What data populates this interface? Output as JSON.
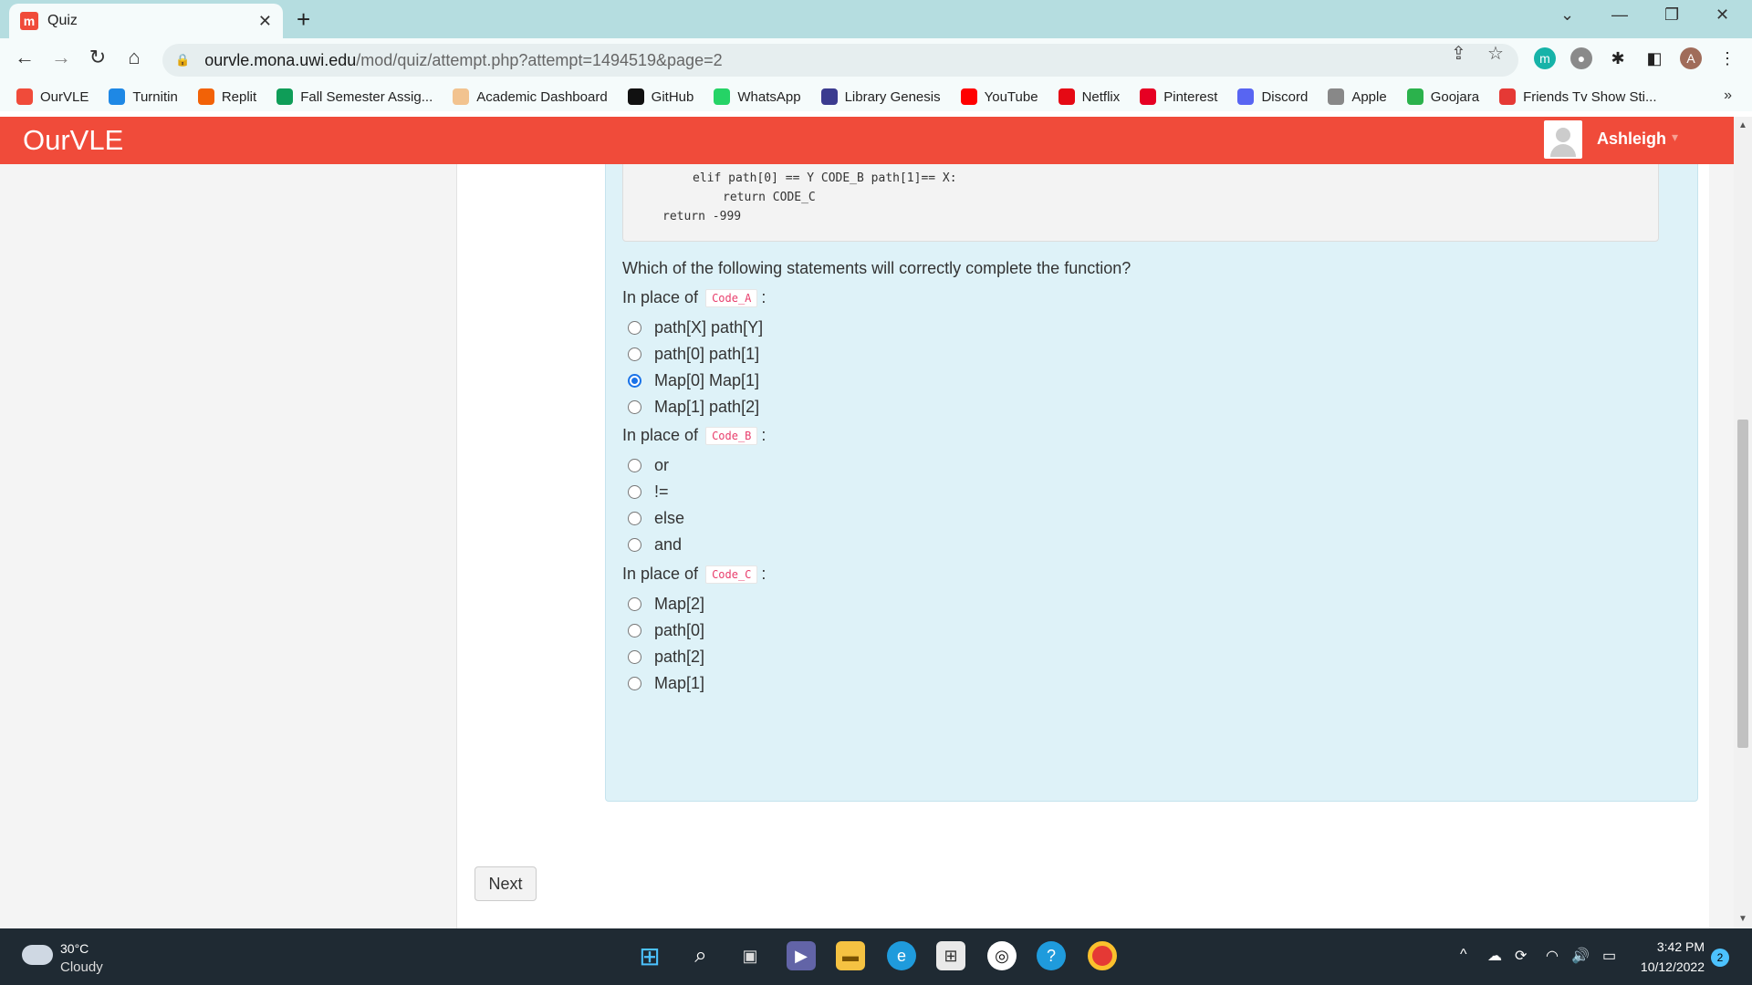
{
  "browser": {
    "tab_title": "Quiz",
    "url_host": "ourvle.mona.uwi.edu",
    "url_path": "/mod/quiz/attempt.php?attempt=1494519&page=2",
    "profile_initial": "A",
    "extension_initial": "m"
  },
  "bookmarks": [
    {
      "label": "OurVLE",
      "icon": "ourvle-icon",
      "color": "#f04b3a"
    },
    {
      "label": "Turnitin",
      "icon": "turnitin-icon",
      "color": "#1e88e5"
    },
    {
      "label": "Replit",
      "icon": "replit-icon",
      "color": "#f26207"
    },
    {
      "label": "Fall Semester Assig...",
      "icon": "sheets-icon",
      "color": "#0f9d58"
    },
    {
      "label": "Academic Dashboard",
      "icon": "dashboard-icon",
      "color": "#f2c38f"
    },
    {
      "label": "GitHub",
      "icon": "github-icon",
      "color": "#111111"
    },
    {
      "label": "WhatsApp",
      "icon": "whatsapp-icon",
      "color": "#25d366"
    },
    {
      "label": "Library Genesis",
      "icon": "libgen-icon",
      "color": "#3b3b8f"
    },
    {
      "label": "YouTube",
      "icon": "youtube-icon",
      "color": "#ff0000"
    },
    {
      "label": "Netflix",
      "icon": "netflix-icon",
      "color": "#e50914"
    },
    {
      "label": "Pinterest",
      "icon": "pinterest-icon",
      "color": "#e60023"
    },
    {
      "label": "Discord",
      "icon": "discord-icon",
      "color": "#5865f2"
    },
    {
      "label": "Apple",
      "icon": "apple-icon",
      "color": "#888888"
    },
    {
      "label": "Goojara",
      "icon": "goojara-icon",
      "color": "#2bb24c"
    },
    {
      "label": "Friends Tv Show Sti...",
      "icon": "friends-icon",
      "color": "#e53935"
    }
  ],
  "site": {
    "brand": "OurVLE",
    "user_name": "Ashleigh",
    "brand_color": "#f04b3a"
  },
  "question": {
    "code_lines": [
      "elif path[0] == Y CODE_B path[1]== X:",
      "return CODE_C",
      "return -999"
    ],
    "prompt": "Which of the following statements will correctly complete the function?",
    "groups": [
      {
        "label": "In place of",
        "code": "Code_A",
        "suffix": ":",
        "options": [
          "path[X] path[Y]",
          "path[0] path[1]",
          "Map[0] Map[1]",
          "Map[1] path[2]"
        ],
        "selected": 2
      },
      {
        "label": "In place of",
        "code": "Code_B",
        "suffix": ":",
        "options": [
          "or",
          "!=",
          "else",
          "and"
        ],
        "selected": -1
      },
      {
        "label": "In place of",
        "code": "Code_C",
        "suffix": ":",
        "options": [
          "Map[2]",
          "path[0]",
          "path[2]",
          "Map[1]"
        ],
        "selected": -1
      }
    ]
  },
  "next_label": "Next",
  "taskbar": {
    "temperature": "30°C",
    "weather": "Cloudy",
    "time": "3:42 PM",
    "date": "10/12/2022",
    "notification_count": "2"
  }
}
